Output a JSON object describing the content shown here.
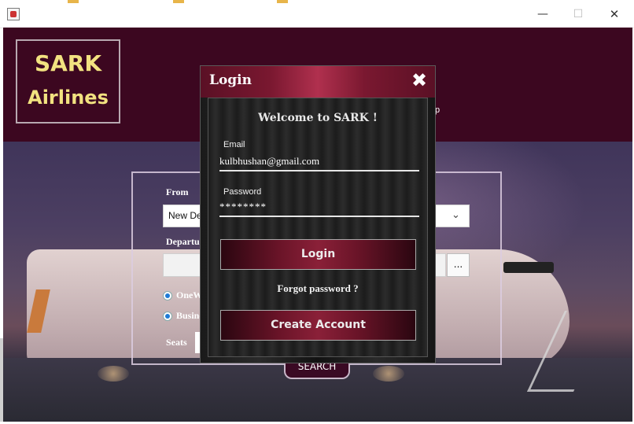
{
  "window": {
    "min_glyph": "—",
    "max_glyph": "☐",
    "close_glyph": "✕"
  },
  "header": {
    "logo_line1": "SARK",
    "logo_line2": "Airlines",
    "partial_text": "p"
  },
  "search_form": {
    "from_label": "From",
    "from_value": "New De",
    "departure_label": "Departu",
    "date_button_label": "...",
    "trip_type_option": "OneW",
    "class_option": "Busine",
    "seats_label": "Seats",
    "search_button_label": "SEARCH"
  },
  "login_dialog": {
    "title": "Login",
    "close_glyph": "✖",
    "welcome": "Welcome to SARK !",
    "email_label": "Email",
    "email_value": "kulbhushan@gmail.com",
    "password_label": "Password",
    "password_value": "********",
    "login_button": "Login",
    "forgot_password": "Forgot password ?",
    "create_account_button": "Create Account"
  },
  "colors": {
    "header_bg": "#3c0720",
    "logo_text": "#f2e280",
    "dialog_accent": "#7a1830"
  }
}
